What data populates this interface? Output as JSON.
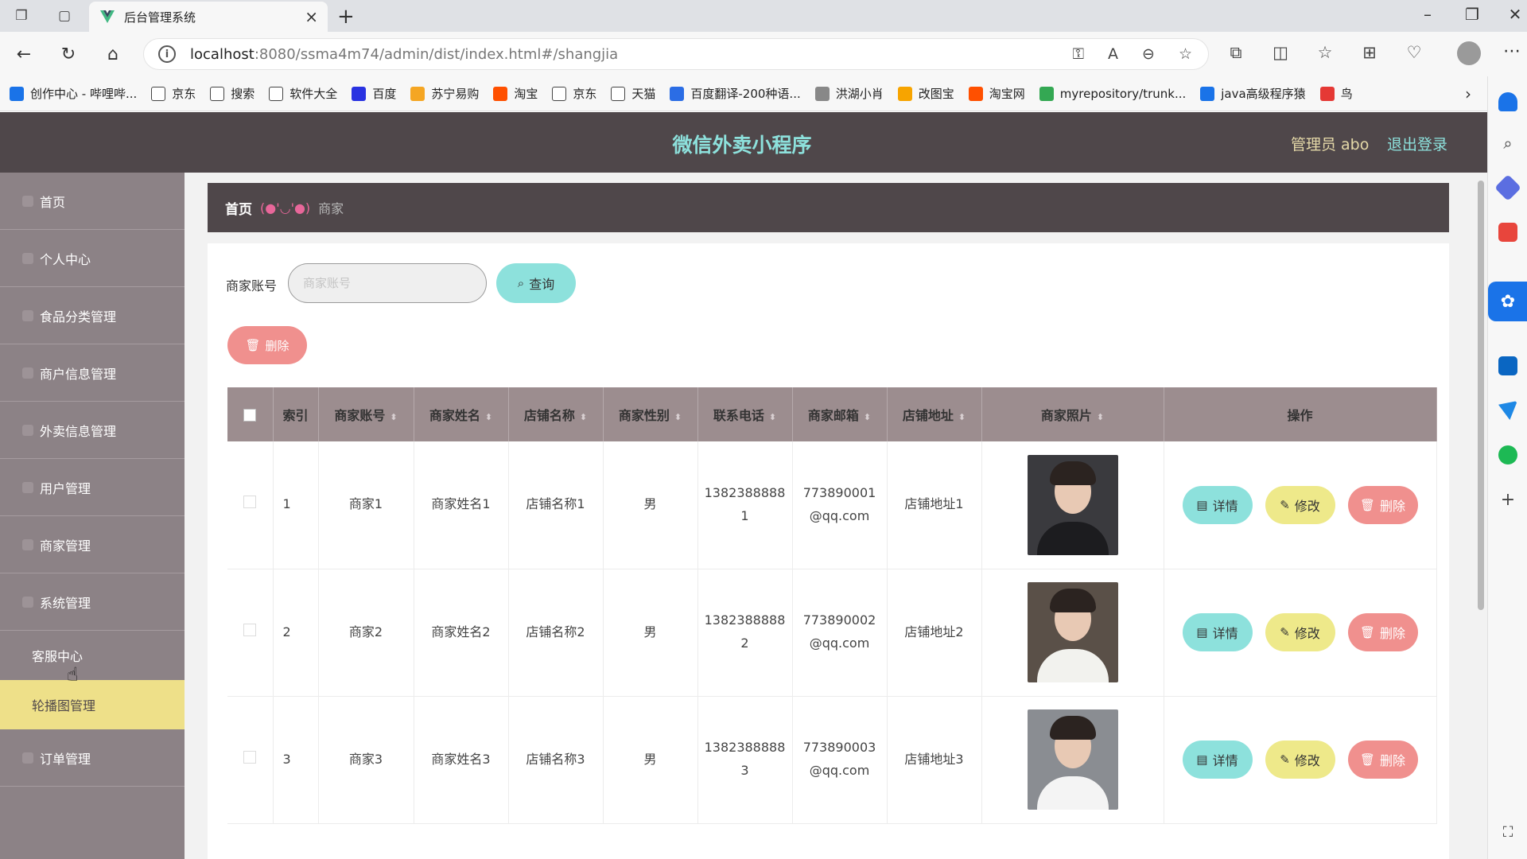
{
  "browser": {
    "tab_title": "后台管理系统",
    "url_host": "localhost",
    "url_rest": ":8080/ssma4m74/admin/dist/index.html#/shangjia",
    "bookmarks": [
      {
        "label": "创作中心 - 哔哩哔...",
        "color": "#1a73e8"
      },
      {
        "label": "京东",
        "color": "#ffffff"
      },
      {
        "label": "搜索",
        "color": "#ffffff"
      },
      {
        "label": "软件大全",
        "color": "#ffffff"
      },
      {
        "label": "百度",
        "color": "#2932e1"
      },
      {
        "label": "苏宁易购",
        "color": "#f5a623"
      },
      {
        "label": "淘宝",
        "color": "#ff5000"
      },
      {
        "label": "京东",
        "color": "#ffffff"
      },
      {
        "label": "天猫",
        "color": "#ffffff"
      },
      {
        "label": "百度翻译-200种语...",
        "color": "#2b6de5"
      },
      {
        "label": "洪湖小肖",
        "color": "#888888"
      },
      {
        "label": "改图宝",
        "color": "#f7a400"
      },
      {
        "label": "淘宝网",
        "color": "#ff5000"
      },
      {
        "label": "myrepository/trunk...",
        "color": "#34a853"
      },
      {
        "label": "java高级程序猿",
        "color": "#1a73e8"
      },
      {
        "label": "鸟",
        "color": "#e53935"
      }
    ]
  },
  "app": {
    "title": "微信外卖小程序",
    "admin_label": "管理员 abo",
    "logout": "退出登录"
  },
  "sidebar": {
    "items": [
      {
        "label": "首页"
      },
      {
        "label": "个人中心"
      },
      {
        "label": "食品分类管理"
      },
      {
        "label": "商户信息管理"
      },
      {
        "label": "外卖信息管理"
      },
      {
        "label": "用户管理"
      },
      {
        "label": "商家管理"
      },
      {
        "label": "系统管理"
      }
    ],
    "subitems": [
      {
        "label": "客服中心"
      },
      {
        "label": "轮播图管理"
      }
    ],
    "last_item": {
      "label": "订单管理"
    }
  },
  "breadcrumb": {
    "home": "首页",
    "sep": "(●'◡'●)",
    "current": "商家"
  },
  "search": {
    "label": "商家账号",
    "placeholder": "商家账号",
    "button": "查询"
  },
  "actions": {
    "delete": "删除"
  },
  "table": {
    "headers": [
      "索引",
      "商家账号",
      "商家姓名",
      "店铺名称",
      "商家性别",
      "联系电话",
      "商家邮箱",
      "店铺地址",
      "商家照片",
      "操作"
    ],
    "rows": [
      {
        "index": "1",
        "account": "商家1",
        "name": "商家姓名1",
        "shop": "店铺名称1",
        "gender": "男",
        "phone_a": "1382388888",
        "phone_b": "1",
        "email_a": "773890001",
        "email_b": "@qq.com",
        "address": "店铺地址1",
        "photo_bg": "#3a3a3e",
        "photo_shirt": "#1c1c1f"
      },
      {
        "index": "2",
        "account": "商家2",
        "name": "商家姓名2",
        "shop": "店铺名称2",
        "gender": "男",
        "phone_a": "1382388888",
        "phone_b": "2",
        "email_a": "773890002",
        "email_b": "@qq.com",
        "address": "店铺地址2",
        "photo_bg": "#5a5048",
        "photo_shirt": "#f2f2ee"
      },
      {
        "index": "3",
        "account": "商家3",
        "name": "商家姓名3",
        "shop": "店铺名称3",
        "gender": "男",
        "phone_a": "1382388888",
        "phone_b": "3",
        "email_a": "773890003",
        "email_b": "@qq.com",
        "address": "店铺地址3",
        "photo_bg": "#8a8d92",
        "photo_shirt": "#f4f4f4"
      }
    ],
    "ops": {
      "detail": "详情",
      "edit": "修改",
      "delete": "删除"
    }
  },
  "colors": {
    "header_bg": "#4f474a",
    "title_color": "#8de1dc",
    "sidebar_bg": "#8c8286",
    "active_sub": "#eee089",
    "btn_cyan": "#8de1dc",
    "btn_yellow": "#eee98a",
    "btn_pink": "#f0908e"
  }
}
